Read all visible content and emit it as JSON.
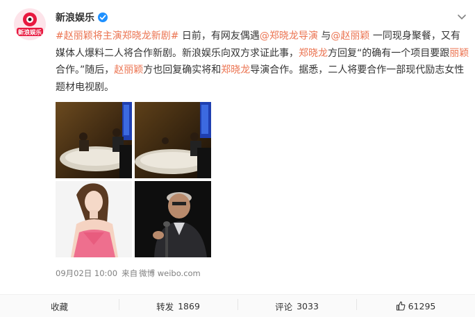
{
  "post": {
    "author": "新浪娱乐",
    "avatar_text": "新浪娱乐",
    "segments": [
      {
        "text": "#赵丽颖将主演郑晓龙新剧#",
        "type": "topic"
      },
      {
        "text": " 日前，有网友偶遇",
        "type": "plain"
      },
      {
        "text": "@郑晓龙导演",
        "type": "mention"
      },
      {
        "text": " 与",
        "type": "plain"
      },
      {
        "text": "@赵丽颖",
        "type": "mention"
      },
      {
        "text": " 一同现身聚餐，又有媒体人爆料二人将合作新剧。新浪娱乐向双方求证此事，",
        "type": "plain"
      },
      {
        "text": "郑晓龙",
        "type": "highlight"
      },
      {
        "text": "方回复“的确有一个项目要跟",
        "type": "plain"
      },
      {
        "text": "丽颖",
        "type": "highlight"
      },
      {
        "text": "合作。”随后，",
        "type": "plain"
      },
      {
        "text": "赵丽颖",
        "type": "highlight"
      },
      {
        "text": "方也回复确实将和",
        "type": "plain"
      },
      {
        "text": "郑晓龙",
        "type": "highlight"
      },
      {
        "text": "导演合作。据悉，二人将要合作一部现代励志女性题材电视剧。",
        "type": "plain"
      }
    ],
    "timestamp": "09月02日 10:00",
    "source_prefix": "来自",
    "source": "微博 weibo.com"
  },
  "images": [
    {
      "name": "dinner-photo-1",
      "desc": "restaurant"
    },
    {
      "name": "dinner-photo-2",
      "desc": "restaurant"
    },
    {
      "name": "actress-photo",
      "desc": "pink dress"
    },
    {
      "name": "director-photo",
      "desc": "microphone"
    }
  ],
  "actions": {
    "collect_label": "收藏",
    "repost_label": "转发",
    "repost_count": "1869",
    "comment_label": "评论",
    "comment_count": "3033",
    "like_count": "61295"
  },
  "colors": {
    "link": "#eb7350",
    "verified": "#1e90ff",
    "meta_text": "#808080"
  },
  "icons": [
    "verified-icon",
    "chevron-down-icon",
    "thumbs-up-icon"
  ]
}
